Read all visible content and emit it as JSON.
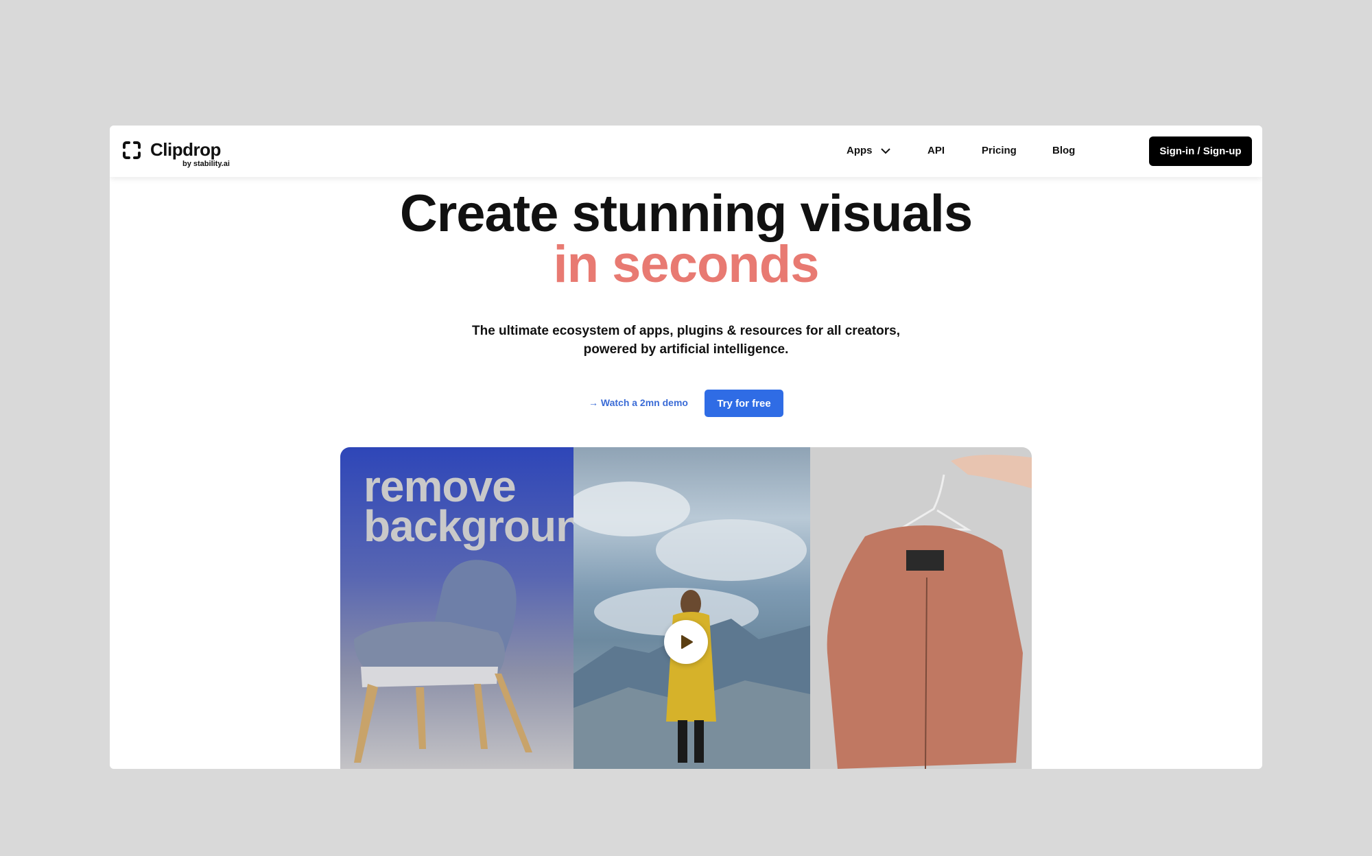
{
  "brand": {
    "name": "Clipdrop",
    "tagline": "by stability.ai"
  },
  "nav": {
    "apps": "Apps",
    "api": "API",
    "pricing": "Pricing",
    "blog": "Blog",
    "signin": "Sign-in / Sign-up"
  },
  "hero": {
    "title_line1": "Create stunning visuals",
    "title_line2": "in seconds",
    "subtitle_line1": "The ultimate ecosystem of apps, plugins & resources for all creators,",
    "subtitle_line2": "powered by artificial intelligence.",
    "demo_link": "→ Watch a 2mn demo",
    "try_button": "Try for free"
  },
  "media": {
    "overlay_line1": "remove",
    "overlay_line2": "background"
  },
  "colors": {
    "accent": "#e87a72",
    "primary_button": "#2f6ce5",
    "link": "#3a6bd6",
    "background": "#d9d9d9"
  },
  "icons": [
    "clipdrop-logo-icon",
    "chevron-down-icon",
    "play-icon"
  ]
}
